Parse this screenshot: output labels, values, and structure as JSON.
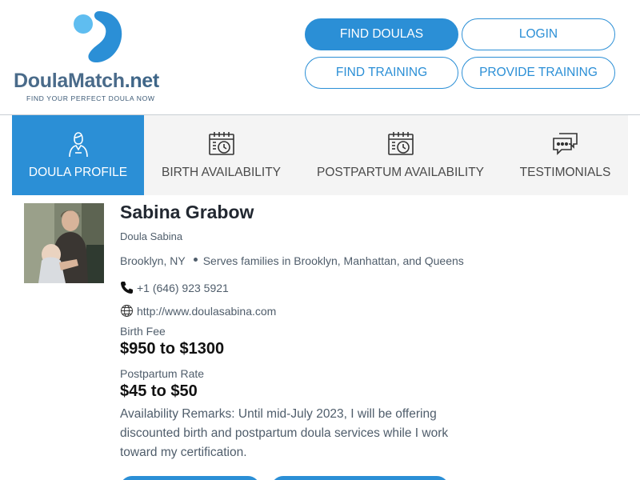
{
  "brand": {
    "name_main": "DoulaMatch",
    "name_suffix": ".net",
    "tagline": "FIND YOUR PERFECT DOULA NOW",
    "accent_color": "#2b8fd6"
  },
  "nav": {
    "find_doulas": "FIND DOULAS",
    "login": "LOGIN",
    "find_training": "FIND TRAINING",
    "provide_training": "PROVIDE TRAINING"
  },
  "tabs": [
    {
      "label": "DOULA PROFILE",
      "icon": "doula-person-icon",
      "active": true
    },
    {
      "label": "BIRTH AVAILABILITY",
      "icon": "calendar-clock-icon",
      "active": false
    },
    {
      "label": "POSTPARTUM AVAILABILITY",
      "icon": "calendar-clock-icon",
      "active": false
    },
    {
      "label": "TESTIMONIALS",
      "icon": "chat-bubbles-icon",
      "active": false
    }
  ],
  "profile": {
    "name": "Sabina Grabow",
    "business": "Doula Sabina",
    "location": "Brooklyn, NY",
    "service_area": "Serves families in Brooklyn, Manhattan, and Queens",
    "phone": "+1 (646) 923 5921",
    "website": "http://www.doulasabina.com",
    "birth_fee_label": "Birth Fee",
    "birth_fee": "$950 to $1300",
    "postpartum_rate_label": "Postpartum Rate",
    "postpartum_rate": "$45 to $50",
    "remarks": "Availability Remarks: Until mid-July 2023, I will be offering discounted birth and postpartum doula services while I work toward my certification."
  }
}
